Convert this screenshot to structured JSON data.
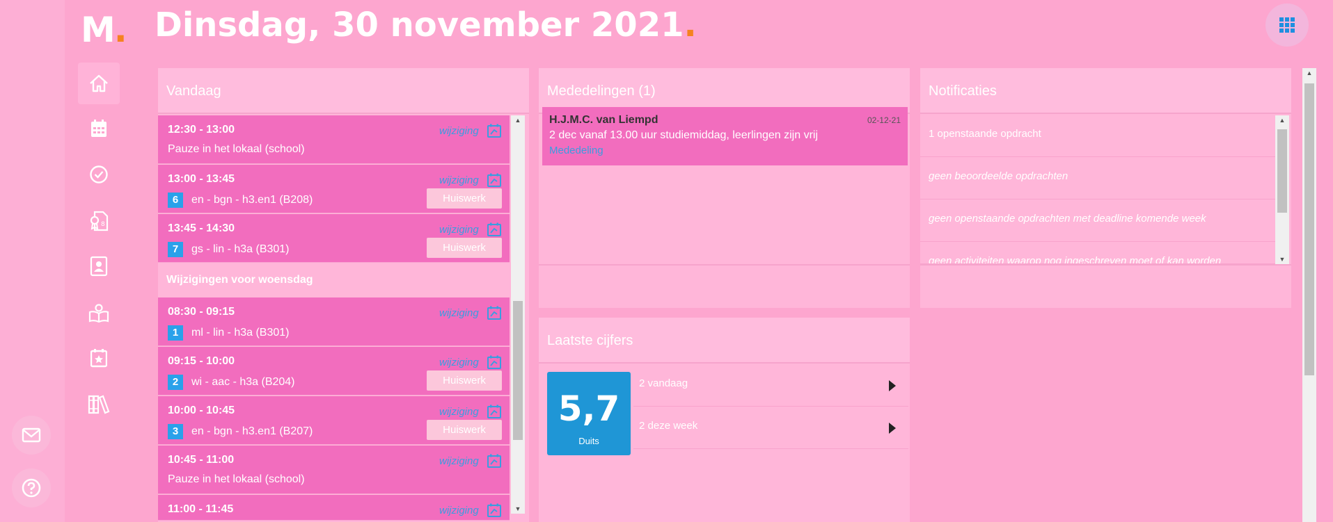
{
  "app": {
    "logo": "M",
    "title": "Dinsdag, 30 november 2021",
    "accent_color": "#f58220"
  },
  "rail": {
    "icons": [
      "mail-icon",
      "help-icon"
    ]
  },
  "nav": {
    "items": [
      "home-icon",
      "calendar-icon",
      "check-circle-icon",
      "grades-icon",
      "contacts-icon",
      "study-guide-icon",
      "activities-icon",
      "books-icon"
    ]
  },
  "vandaag": {
    "title": "Vandaag",
    "day_separator": "Wijzigingen voor woensdag",
    "wijziging_label": "wijziging",
    "homework_label": "Huiswerk",
    "lessons": [
      {
        "time": "12:30 - 13:00",
        "hour": "",
        "desc": "Pauze in het lokaal (school)",
        "homework": false
      },
      {
        "time": "13:00 - 13:45",
        "hour": "6",
        "desc": "en - bgn - h3.en1 (B208)",
        "homework": true
      },
      {
        "time": "13:45 - 14:30",
        "hour": "7",
        "desc": "gs - lin - h3a (B301)",
        "homework": true
      },
      {
        "time": "08:30 - 09:15",
        "hour": "1",
        "desc": "ml - lin - h3a (B301)",
        "homework": false
      },
      {
        "time": "09:15 - 10:00",
        "hour": "2",
        "desc": "wi - aac - h3a (B204)",
        "homework": true
      },
      {
        "time": "10:00 - 10:45",
        "hour": "3",
        "desc": "en - bgn - h3.en1 (B207)",
        "homework": true
      },
      {
        "time": "10:45 - 11:00",
        "hour": "",
        "desc": "Pauze in het lokaal (school)",
        "homework": false
      },
      {
        "time": "11:00 - 11:45",
        "hour": "",
        "desc": "",
        "homework": false
      }
    ]
  },
  "mededelingen": {
    "title": "Mededelingen (1)",
    "items": [
      {
        "sender": "H.J.M.C. van Liempd",
        "date": "02-12-21",
        "text": "2 dec vanaf 13.00 uur studiemiddag, leerlingen zijn vrij",
        "type": "Mededeling"
      }
    ]
  },
  "notificaties": {
    "title": "Notificaties",
    "items": [
      {
        "text": "1 openstaande opdracht",
        "italic": false
      },
      {
        "text": "geen beoordeelde opdrachten",
        "italic": true
      },
      {
        "text": "geen openstaande opdrachten met deadline komende week",
        "italic": true
      },
      {
        "text": "geen activiteiten waarop nog ingeschreven moet of kan worden",
        "italic": true
      }
    ]
  },
  "cijfers": {
    "title": "Laatste cijfers",
    "grade": "5,7",
    "subject": "Duits",
    "rows": [
      "2 vandaag",
      "2 deze week"
    ]
  }
}
